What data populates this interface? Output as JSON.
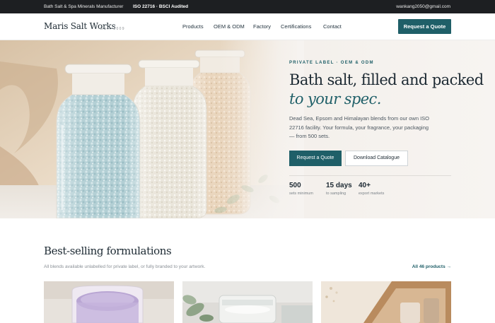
{
  "topbar": {
    "tagline": "Bath Salt & Spa Minerals Manufacturer",
    "cert": "ISO 22716 · BSCI Audited",
    "email": "wankang2050@gmail.com"
  },
  "nav": {
    "logo": "Maris Salt Works",
    "est": "EST. 2009",
    "links": [
      "Products",
      "OEM & ODM",
      "Factory",
      "Certifications",
      "Contact"
    ],
    "cta": "Request a Quote"
  },
  "hero": {
    "eyebrow": "PRIVATE LABEL · OEM & ODM",
    "title_line1": "Bath salt, filled and packed",
    "title_line2": "to your spec.",
    "lead": "Dead Sea, Epsom and Himalayan blends from our own ISO 22716 facility. Your formula, your fragrance, your packaging — from 500 sets.",
    "primary_button": "Request a Quote",
    "secondary_button": "Download Catalogue",
    "stats": [
      {
        "value": "500",
        "label": "sets minimum"
      },
      {
        "value": "15 days",
        "label": "to sampling"
      },
      {
        "value": "40+",
        "label": "export markets"
      }
    ]
  },
  "bestsellers": {
    "title": "Best-selling formulations",
    "subtitle": "All blends available unlabelled for private label, or fully branded to your artwork.",
    "link": "All 46 products →"
  },
  "colors": {
    "accent": "#1f5f68",
    "topbar_bg": "#1d1f22",
    "text": "#1d2a33"
  },
  "icons": {
    "arrow": "arrow-right-icon"
  }
}
